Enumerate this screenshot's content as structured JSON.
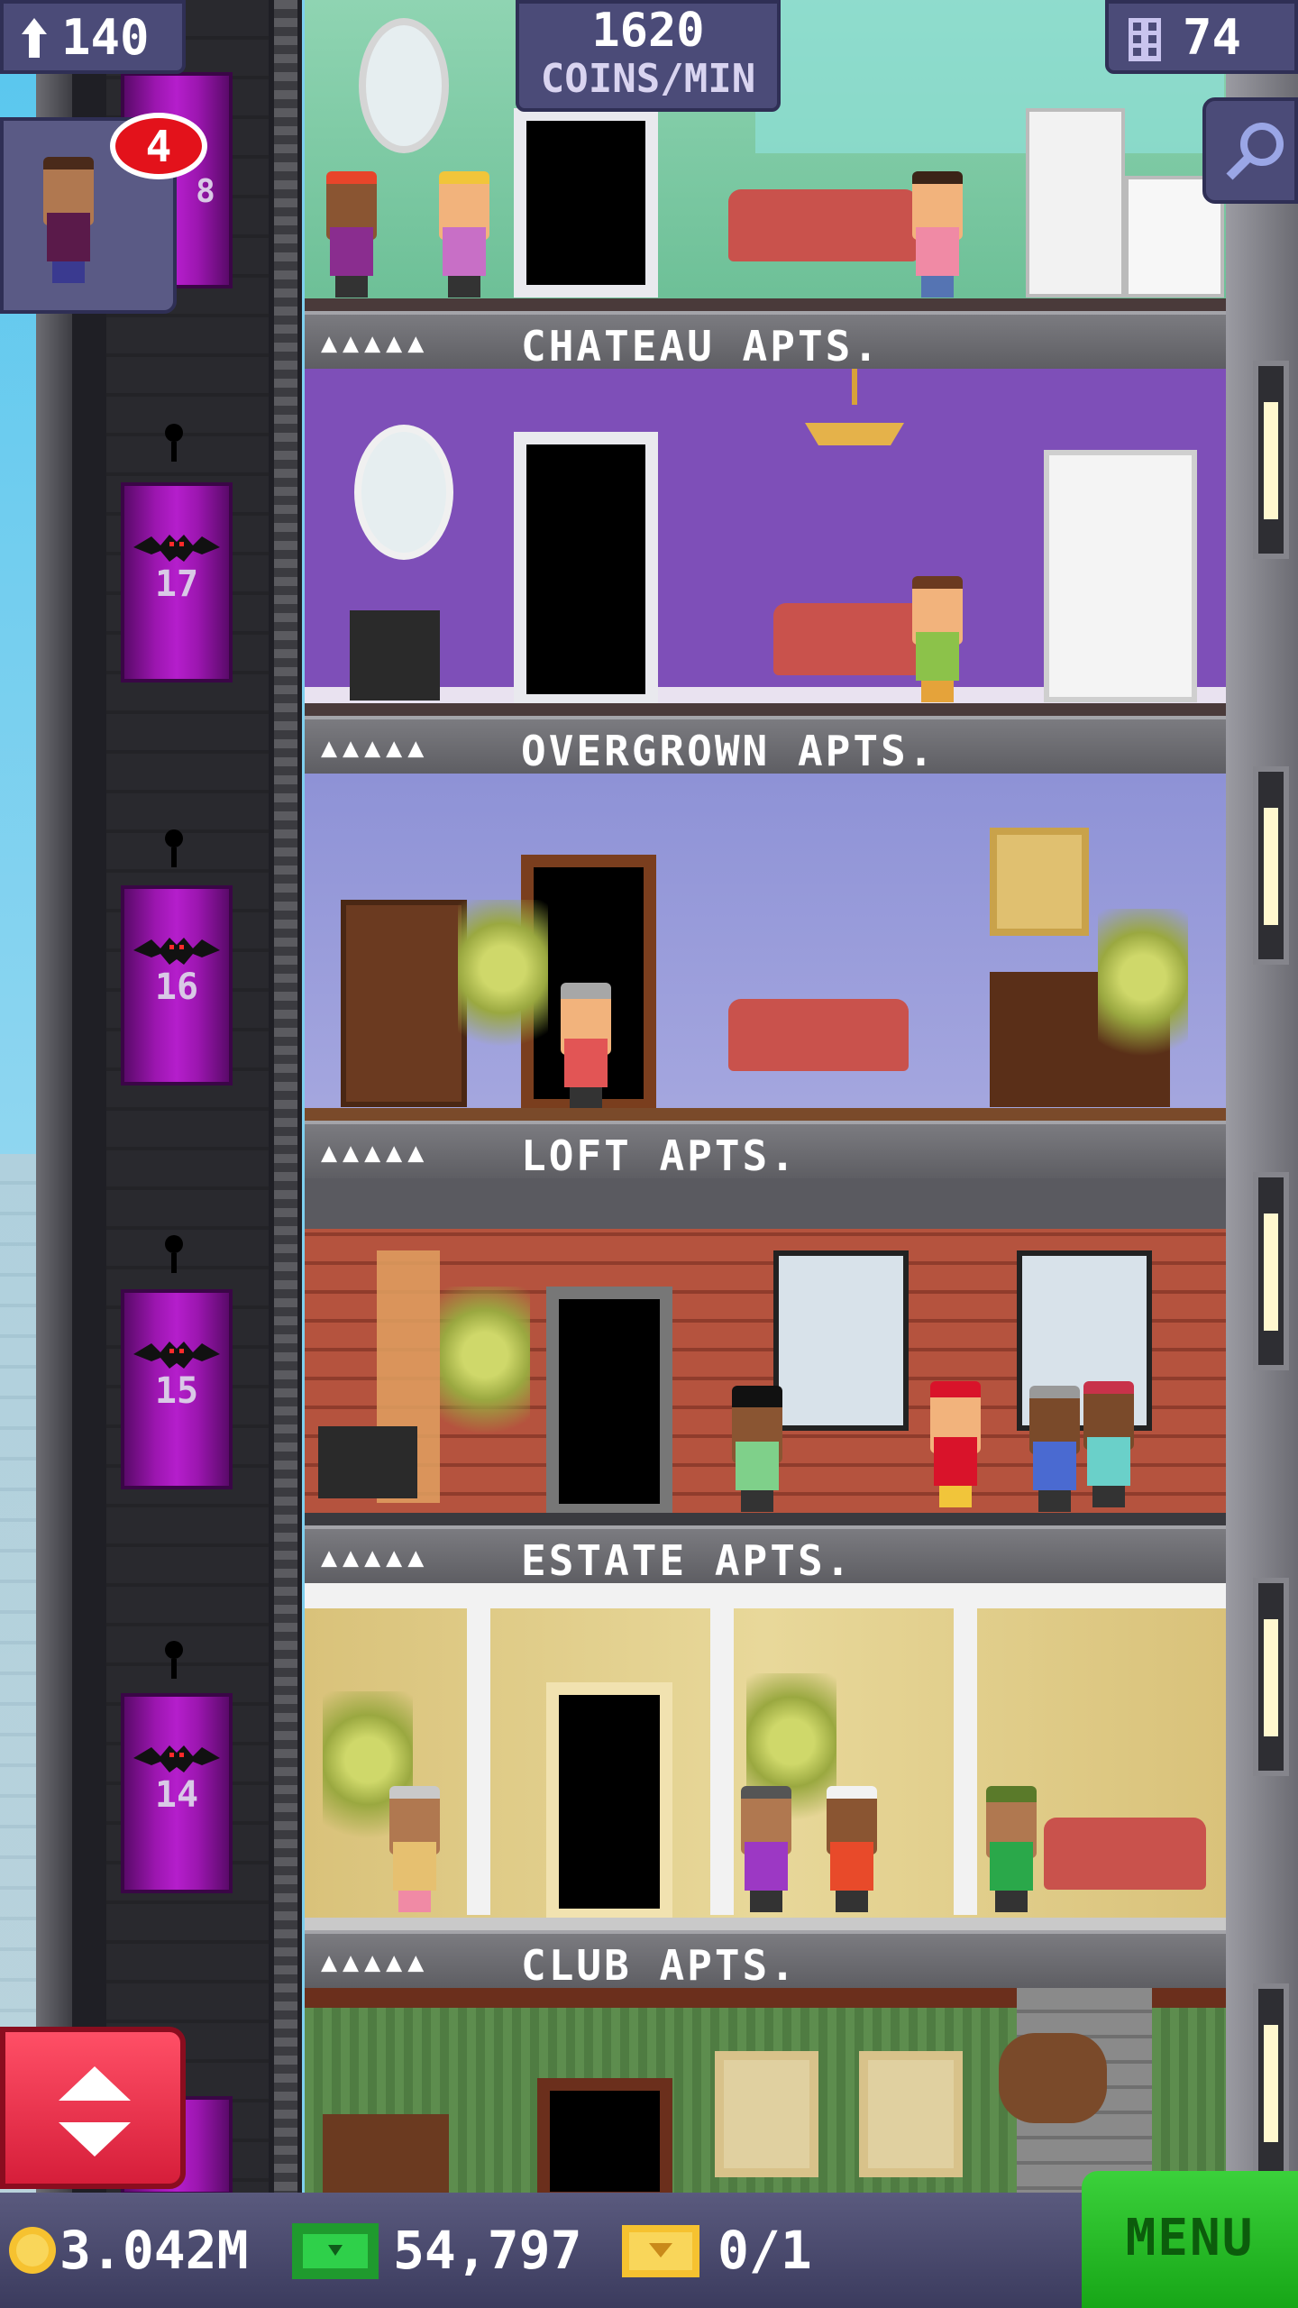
{
  "hud": {
    "population": "140",
    "coins_per_min_value": "1620",
    "coins_per_min_label": "COINS/MIN",
    "floors": "74",
    "visitor_badge_count": "4",
    "coins": "3.042M",
    "bux": "54,797",
    "tickets": "0/1",
    "menu_label": "MENU"
  },
  "floors": [
    {
      "name": "CHATEAU APTS.",
      "pips": "▲▲▲▲▲"
    },
    {
      "name": "OVERGROWN APTS.",
      "pips": "▲▲▲▲▲"
    },
    {
      "name": "LOFT APTS.",
      "pips": "▲▲▲▲▲"
    },
    {
      "name": "ESTATE APTS.",
      "pips": "▲▲▲▲▲"
    },
    {
      "name": "CLUB APTS.",
      "pips": "▲▲▲▲▲"
    }
  ],
  "elevator": {
    "car_numbers": [
      "17",
      "16",
      "15",
      "14"
    ],
    "top_partial_number": "8"
  },
  "colors": {
    "elevator": "#9c16b0",
    "hud_panel": "#4b4b78",
    "menu": "#21b821",
    "badge": "#e3121b"
  },
  "icons": [
    "population-icon",
    "floors-icon",
    "search-icon",
    "coin-icon",
    "bux-icon",
    "ticket-icon",
    "bat-icon",
    "up-down-arrows-icon"
  ]
}
